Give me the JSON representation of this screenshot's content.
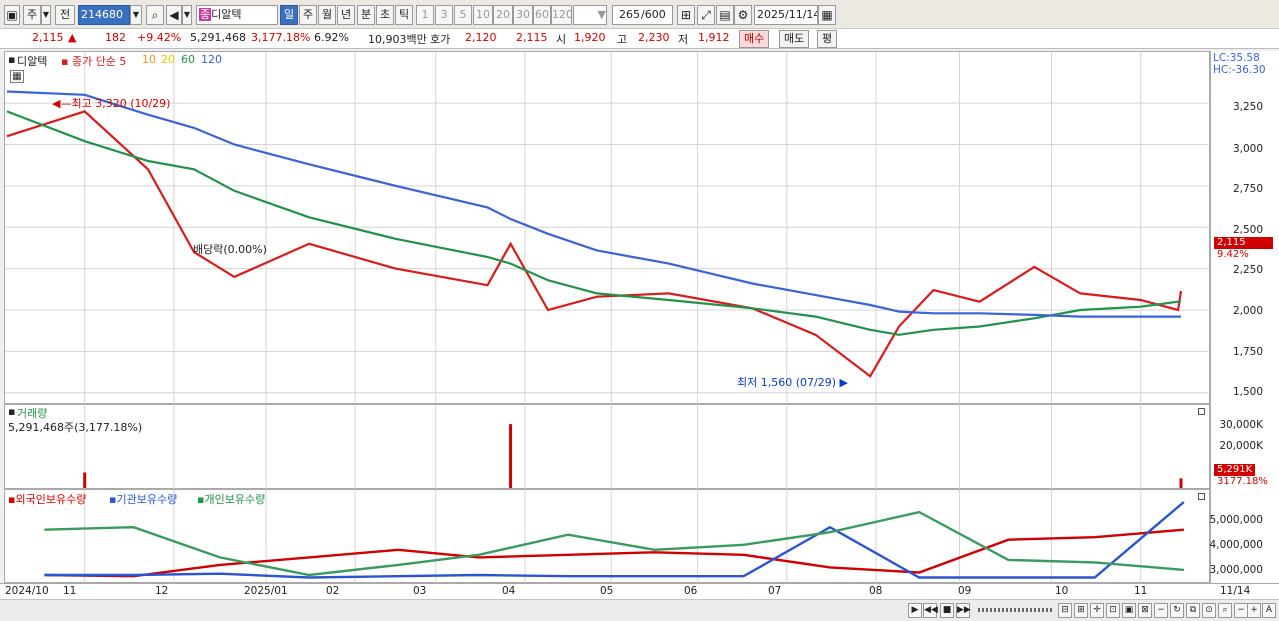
{
  "toolbar": {
    "market": "주",
    "period_type": "전",
    "code": "214680",
    "company": "디알텍",
    "periods": [
      "일",
      "주",
      "월",
      "년",
      "분",
      "초",
      "틱"
    ],
    "intervals": [
      "1",
      "3",
      "5",
      "10",
      "20",
      "30",
      "60",
      "120"
    ],
    "count_value": "265",
    "count_total": "/600",
    "date": "2025/11/14"
  },
  "quote": {
    "price": "2,115",
    "arrow": "▲",
    "change": "182",
    "change_pct": "+9.42%",
    "volume": "5,291,468",
    "volume_pct": "3,177.18%",
    "turnover_pct": "6.92%",
    "amount": "10,903백만",
    "bid_label": "호가",
    "bid": "2,120",
    "ask": "2,115",
    "open_label": "시",
    "open": "1,920",
    "high_label": "고",
    "high": "2,230",
    "low_label": "저",
    "low": "1,912",
    "buy_btn": "매수",
    "sell_btn": "매도",
    "eval_btn": "평"
  },
  "price_panel": {
    "name": "디알텍",
    "ma_label": "종가 단순 5",
    "ma_periods": [
      "10",
      "20",
      "60",
      "120"
    ],
    "lc": "LC:35.58",
    "hc": "HC:-36.30",
    "max_note": "최고 3,320 (10/29)",
    "min_note": "최저 1,560 (07/29)",
    "div_note": "배당락(0.00%)",
    "price_tag": "2,115",
    "pct_tag": "9.42%",
    "y_tick_labels": [
      "3,250",
      "3,000",
      "2,750",
      "2,500",
      "2,250",
      "2,000",
      "1,750",
      "1,500"
    ]
  },
  "volume_panel": {
    "title": "거래량",
    "info": "5,291,468주(3,177.18%)",
    "y_tick_labels": [
      "30,000K",
      "20,000K"
    ],
    "vol_tag": "5,291K",
    "pct_tag": "3177.18%"
  },
  "holdings_panel": {
    "legend": [
      "외국인보유수량",
      "기관보유수량",
      "개인보유수량"
    ],
    "y_tick_labels": [
      "5,000,000",
      "4,000,000",
      "3,000,000"
    ]
  },
  "x_axis": {
    "labels": [
      "2024/10",
      "11",
      "12",
      "2025/01",
      "02",
      "03",
      "04",
      "05",
      "06",
      "07",
      "08",
      "09",
      "10",
      "11"
    ],
    "right_label": "11/14"
  },
  "colors": {
    "up": "#d10000",
    "down": "#0a3cc4",
    "ma5": "#d81b1b",
    "ma10": "#f0901e",
    "ma20": "#f5e21a",
    "ma60": "#22924a",
    "ma120": "#3a63d8"
  },
  "chart_data": [
    {
      "type": "line",
      "title": "디알텍",
      "ylim": [
        1450,
        3450
      ],
      "x": [
        "2024-10-02",
        "2024-10-29",
        "2024-11-20",
        "2024-12-06",
        "2024-12-20",
        "2025-01-15",
        "2025-02-14",
        "2025-03-18",
        "2025-03-26",
        "2025-04-08",
        "2025-04-25",
        "2025-05-20",
        "2025-06-18",
        "2025-07-10",
        "2025-07-29",
        "2025-08-08",
        "2025-08-20",
        "2025-09-05",
        "2025-09-24",
        "2025-10-10",
        "2025-10-31",
        "2025-11-13",
        "2025-11-14"
      ],
      "series": [
        {
          "name": "종가",
          "values": [
            3050,
            3200,
            2850,
            2350,
            2200,
            2400,
            2250,
            2150,
            2400,
            2000,
            2080,
            2100,
            2010,
            1850,
            1600,
            1900,
            2120,
            2050,
            2260,
            2100,
            2060,
            2000,
            2115
          ]
        },
        {
          "name": "60",
          "values": [
            3200,
            3020,
            2900,
            2850,
            2720,
            2560,
            2430,
            2320,
            2280,
            2180,
            2100,
            2060,
            2010,
            1960,
            1880,
            1850,
            1880,
            1900,
            1950,
            2000,
            2020,
            2050,
            2055
          ]
        },
        {
          "name": "120",
          "values": [
            3320,
            3300,
            3180,
            3100,
            3000,
            2880,
            2750,
            2620,
            2550,
            2460,
            2360,
            2280,
            2160,
            2090,
            2030,
            1990,
            1980,
            1980,
            1970,
            1960,
            1960,
            1960,
            1960
          ]
        }
      ]
    },
    {
      "type": "bar",
      "title": "거래량",
      "ylim": [
        0,
        40000
      ],
      "x": [
        "2024-10-29",
        "2025-03-26",
        "2025-11-14"
      ],
      "series": [
        {
          "name": "거래량",
          "values": [
            8500,
            35000,
            5291
          ]
        }
      ]
    },
    {
      "type": "line",
      "ylim": [
        2700000,
        5800000
      ],
      "x": [
        "2024-10",
        "2024-11",
        "2024-12",
        "2025-01",
        "2025-02",
        "2025-03",
        "2025-04",
        "2025-05",
        "2025-06",
        "2025-07",
        "2025-08",
        "2025-09",
        "2025-10",
        "2025-11"
      ],
      "series": [
        {
          "name": "외국인보유수량",
          "values": [
            2900000,
            2850000,
            3300000,
            3600000,
            3900000,
            3600000,
            3700000,
            3800000,
            3700000,
            3200000,
            3000000,
            4300000,
            4400000,
            4700000
          ]
        },
        {
          "name": "기관보유수량",
          "values": [
            2900000,
            2900000,
            2950000,
            2800000,
            2850000,
            2900000,
            2850000,
            2850000,
            2850000,
            4800000,
            2800000,
            2800000,
            2800000,
            5800000
          ]
        },
        {
          "name": "개인보유수량",
          "values": [
            4700000,
            4800000,
            3600000,
            2900000,
            3300000,
            3700000,
            4500000,
            3900000,
            4100000,
            4600000,
            5400000,
            3500000,
            3400000,
            3100000
          ]
        }
      ]
    }
  ]
}
